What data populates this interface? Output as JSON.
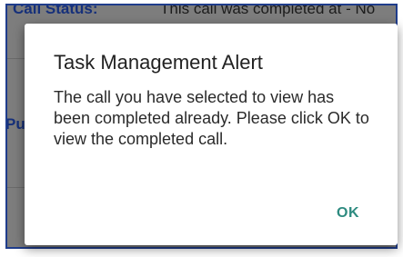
{
  "background": {
    "row1_label": "Call Status:",
    "row1_value": "This call was completed at - No",
    "row2_label": "Pu"
  },
  "dialog": {
    "title": "Task Management Alert",
    "message": "The call you have selected to view has been completed already. Please click OK to view the completed call.",
    "ok_label": "OK"
  },
  "colors": {
    "accent": "#2e8b80",
    "label_blue": "#16307a",
    "overlay_gray": "#7d7d7d"
  }
}
